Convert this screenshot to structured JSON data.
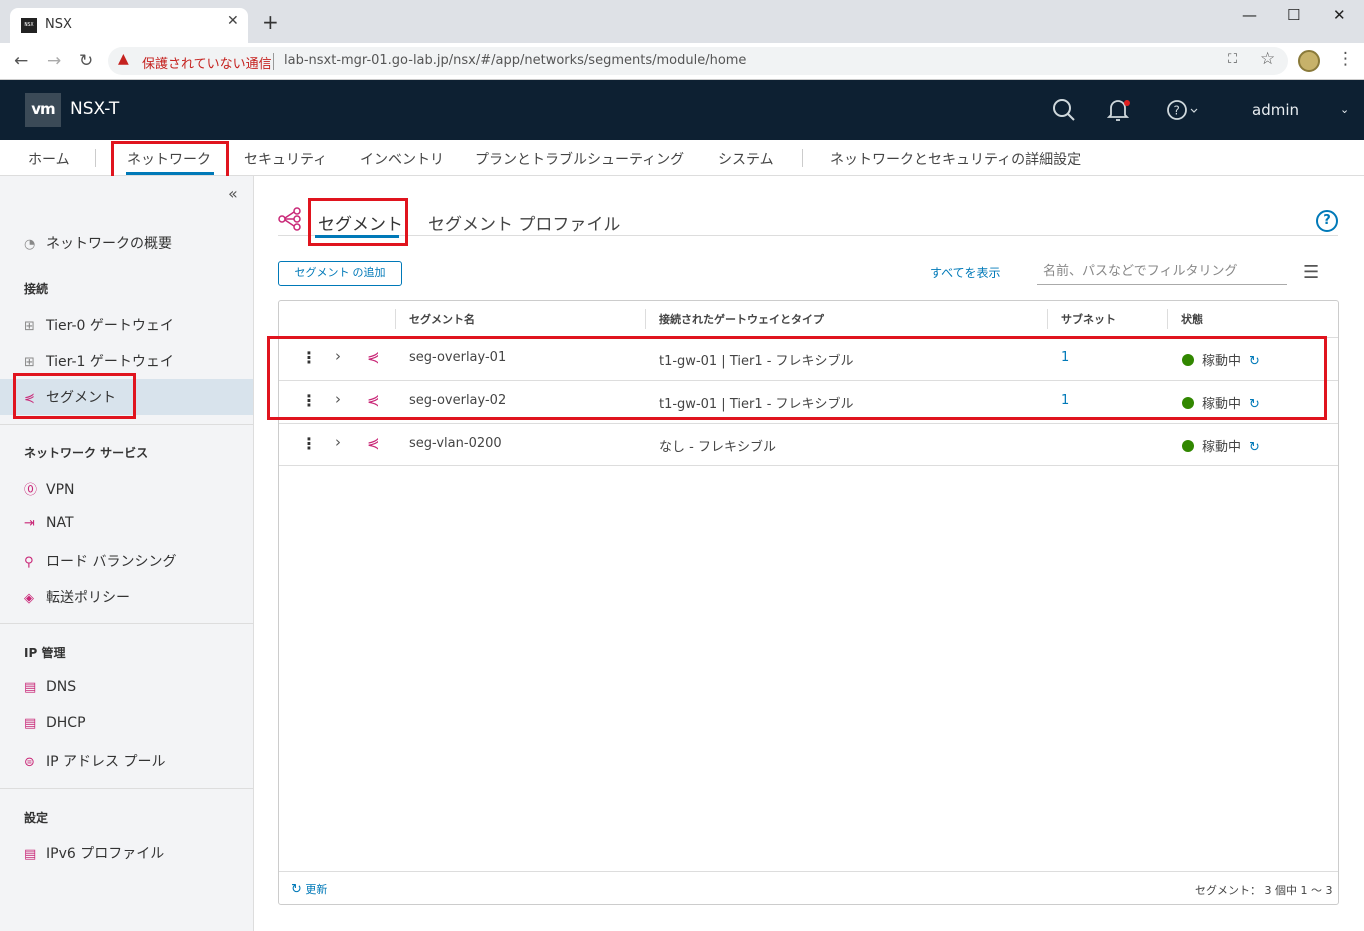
{
  "browser": {
    "tab_title": "NSX",
    "favicon_text": "NSX",
    "security_warning": "保護されていない通信",
    "url": "lab-nsxt-mgr-01.go-lab.jp/nsx/#/app/networks/segments/module/home"
  },
  "header": {
    "logo": "vm",
    "product": "NSX-T",
    "user": "admin"
  },
  "nav": {
    "home": "ホーム",
    "network": "ネットワーク",
    "security": "セキュリティ",
    "inventory": "インベントリ",
    "plan": "プランとトラブルシューティング",
    "system": "システム",
    "advanced": "ネットワークとセキュリティの詳細設定"
  },
  "sidebar": {
    "overview": "ネットワークの概要",
    "connectivity_head": "接続",
    "tier0": "Tier-0 ゲートウェイ",
    "tier1": "Tier-1 ゲートウェイ",
    "segment": "セグメント",
    "services_head": "ネットワーク サービス",
    "vpn": "VPN",
    "nat": "NAT",
    "lb": "ロード バランシング",
    "forwarding": "転送ポリシー",
    "ip_head": "IP 管理",
    "dns": "DNS",
    "dhcp": "DHCP",
    "ippool": "IP アドレス プール",
    "settings_head": "設定",
    "ipv6": "IPv6 プロファイル"
  },
  "main": {
    "tab_segments": "セグメント",
    "tab_profiles": "セグメント プロファイル",
    "help": "?",
    "add_button": "セグメント の追加",
    "show_all": "すべてを表示",
    "filter_placeholder": "名前、パスなどでフィルタリング",
    "columns": {
      "name": "セグメント名",
      "gateway": "接続されたゲートウェイとタイプ",
      "subnet": "サブネット",
      "status": "状態"
    },
    "rows": [
      {
        "name": "seg-overlay-01",
        "gateway": "t1-gw-01 | Tier1 - フレキシブル",
        "subnet": "1",
        "status": "稼動中"
      },
      {
        "name": "seg-overlay-02",
        "gateway": "t1-gw-01 | Tier1 - フレキシブル",
        "subnet": "1",
        "status": "稼動中"
      },
      {
        "name": "seg-vlan-0200",
        "gateway": "なし - フレキシブル",
        "subnet": "",
        "status": "稼動中"
      }
    ],
    "refresh": "更新",
    "count": "セグメント： 3 個中 1 ～ 3"
  },
  "colors": {
    "header_bg": "#0d2032",
    "accent": "#0079b8",
    "status_green": "#318700",
    "segment_icon": "#c92777",
    "highlight_red": "#e0141e"
  }
}
